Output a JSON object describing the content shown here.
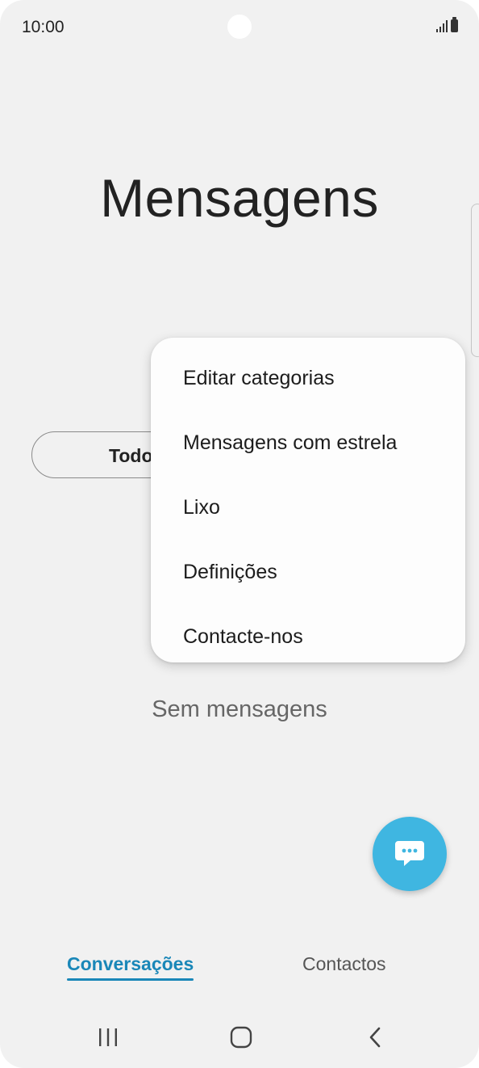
{
  "status_bar": {
    "time": "10:00",
    "signal_icon": "signal-icon",
    "battery_icon": "battery-icon"
  },
  "header": {
    "title": "Mensagens"
  },
  "category_filter": {
    "label": "Todo"
  },
  "menu": {
    "items": [
      {
        "label": "Editar categorias"
      },
      {
        "label": "Mensagens com estrela"
      },
      {
        "label": "Lixo"
      },
      {
        "label": "Definições"
      },
      {
        "label": "Contacte-nos"
      }
    ]
  },
  "empty_state": {
    "text": "Sem mensagens"
  },
  "fab": {
    "icon": "new-message-icon",
    "color": "#3fb6e1"
  },
  "tabs": [
    {
      "label": "Conversações",
      "active": true
    },
    {
      "label": "Contactos",
      "active": false
    }
  ],
  "colors": {
    "accent": "#1a87b8",
    "fab": "#3fb6e1",
    "background": "#f1f1f1"
  },
  "nav_bar": {
    "recents_icon": "recents-icon",
    "home_icon": "home-icon",
    "back_icon": "back-icon"
  }
}
